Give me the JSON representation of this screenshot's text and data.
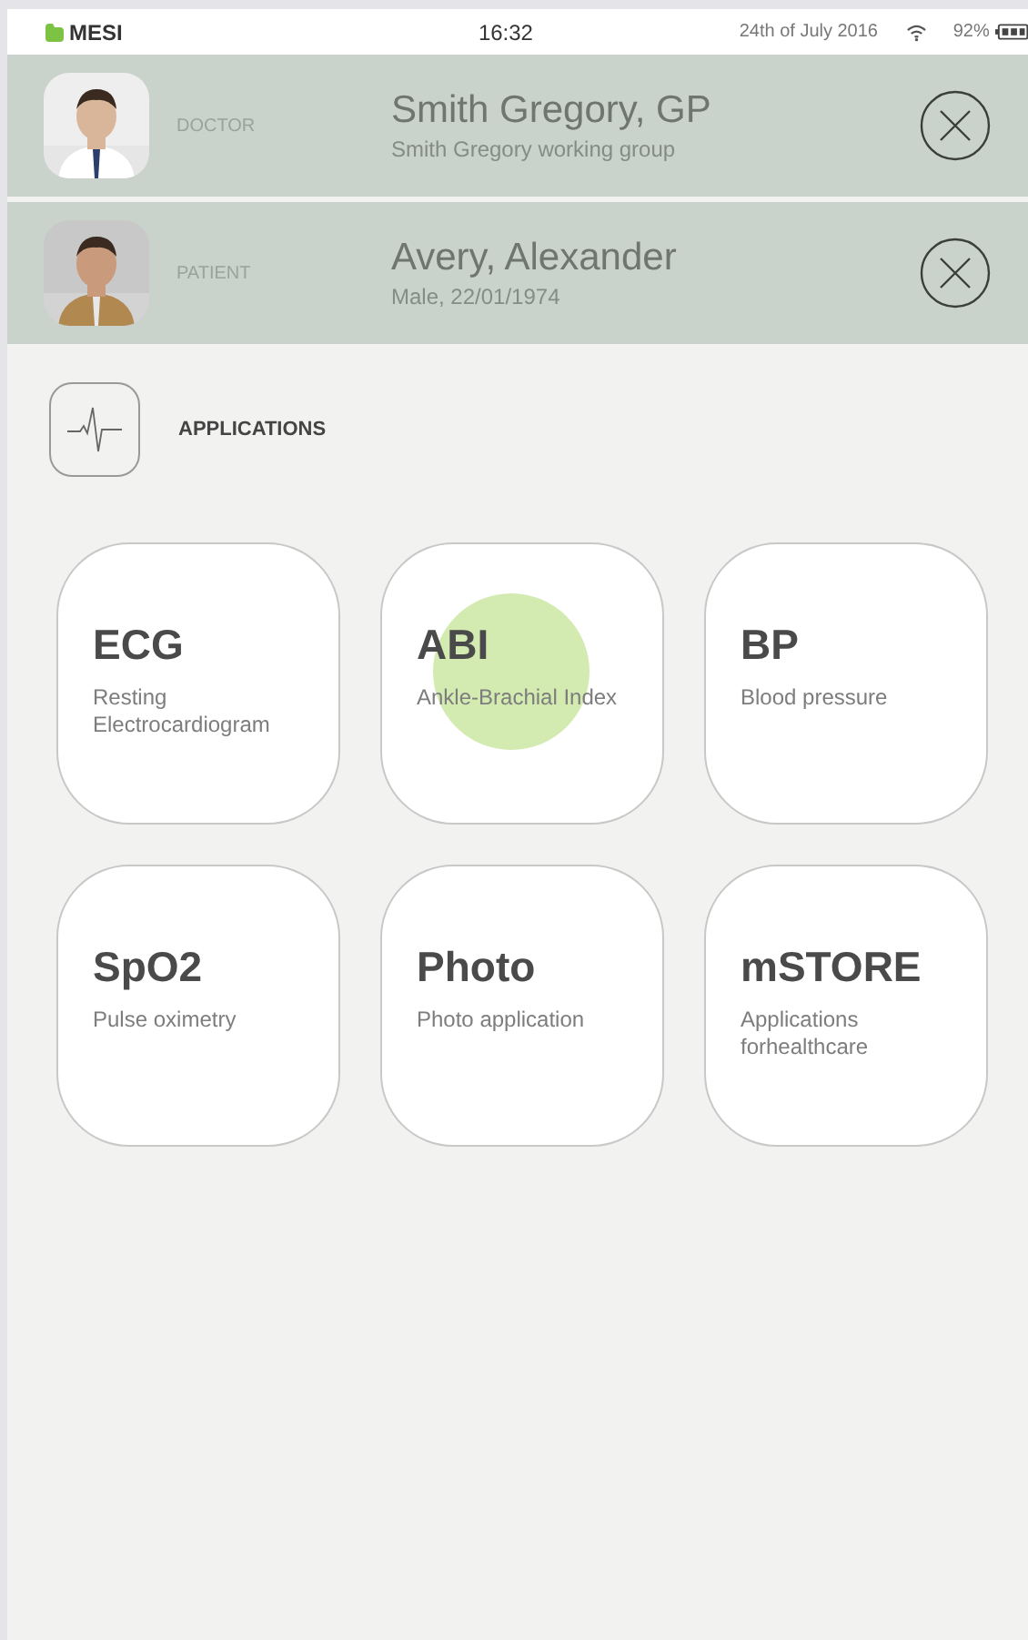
{
  "status_bar": {
    "app": "MESI",
    "time": "16:32",
    "date": "24th of July 2016",
    "battery": "92%"
  },
  "people": [
    {
      "role": "DOCTOR",
      "name": "Smith Gregory, GP",
      "detail": "Smith Gregory working group",
      "kind": "picture"
    },
    {
      "role": "PATIENT",
      "name": "Avery, Alexander",
      "detail": "Male, 22/01/1974",
      "kind": "picture"
    }
  ],
  "section": {
    "title": "APPLICATIONS"
  },
  "apps": [
    {
      "title": "ECG",
      "subtitle": "Resting Electrocardiogram",
      "touched": false
    },
    {
      "title": "ABI",
      "subtitle": "Ankle-Brachial Index",
      "touched": true
    },
    {
      "title": "BP",
      "subtitle": "Blood pressure",
      "touched": false
    },
    {
      "title": "SpO2",
      "subtitle": "Pulse oximetry",
      "touched": false
    },
    {
      "title": "Photo",
      "subtitle": "Photo application",
      "touched": false
    },
    {
      "title": "mSTORE",
      "subtitle": "Applications forhealthcare",
      "touched": false
    }
  ]
}
